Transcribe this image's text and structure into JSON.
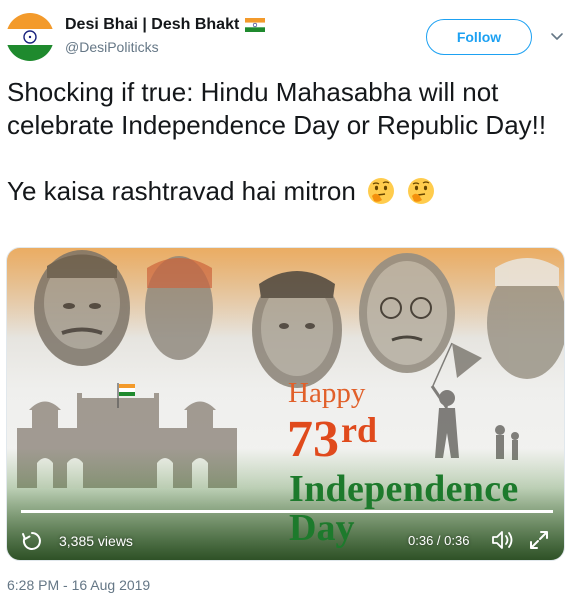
{
  "author": {
    "display_name": "Desi Bhai | Desh Bhakt",
    "handle": "@DesiPoliticks",
    "name_emoji": "india-flag-icon"
  },
  "header": {
    "follow_label": "Follow",
    "menu_icon": "chevron-down-icon"
  },
  "tweet": {
    "line1": "Shocking if true: Hindu Mahasabha will not celebrate Independence Day or Republic Day!!",
    "line2": "Ye kaisa rashtravad hai mitron",
    "emojis": [
      "thinking-face-icon",
      "thinking-face-icon"
    ]
  },
  "media": {
    "happy": "Happy",
    "number": "73",
    "suffix": "rd",
    "independence": "Independence",
    "day": "Day",
    "views": "3,385 views",
    "time": "0:36 / 0:36",
    "progress": 1.0
  },
  "footer": {
    "timestamp": "6:28 PM - 16 Aug 2019"
  },
  "colors": {
    "accent": "#1da1f2",
    "text": "#14171a",
    "muted": "#657786",
    "saffron": "#e1602a",
    "green": "#1d7a2c"
  }
}
